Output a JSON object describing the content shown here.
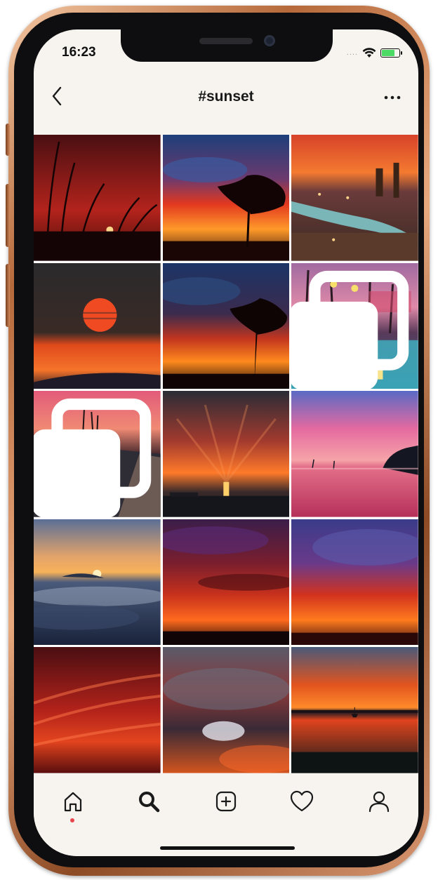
{
  "status_bar": {
    "time": "16:23",
    "signal": "....",
    "battery_level": 0.7
  },
  "header": {
    "title": "#sunset"
  },
  "icons": {
    "back": "chevron-left-icon",
    "more": "more-horizontal-icon",
    "multi_photo": "multiple-photos-icon",
    "tabs": [
      "home-icon",
      "search-icon",
      "add-post-icon",
      "heart-icon",
      "profile-icon"
    ]
  },
  "tab_bar": {
    "active_tab": "search",
    "notification_dot_on": "home"
  },
  "colors": {
    "notification_dot": "#e8454f",
    "screen_background": "#f7f4ef",
    "battery_fill": "#4cd964"
  }
}
